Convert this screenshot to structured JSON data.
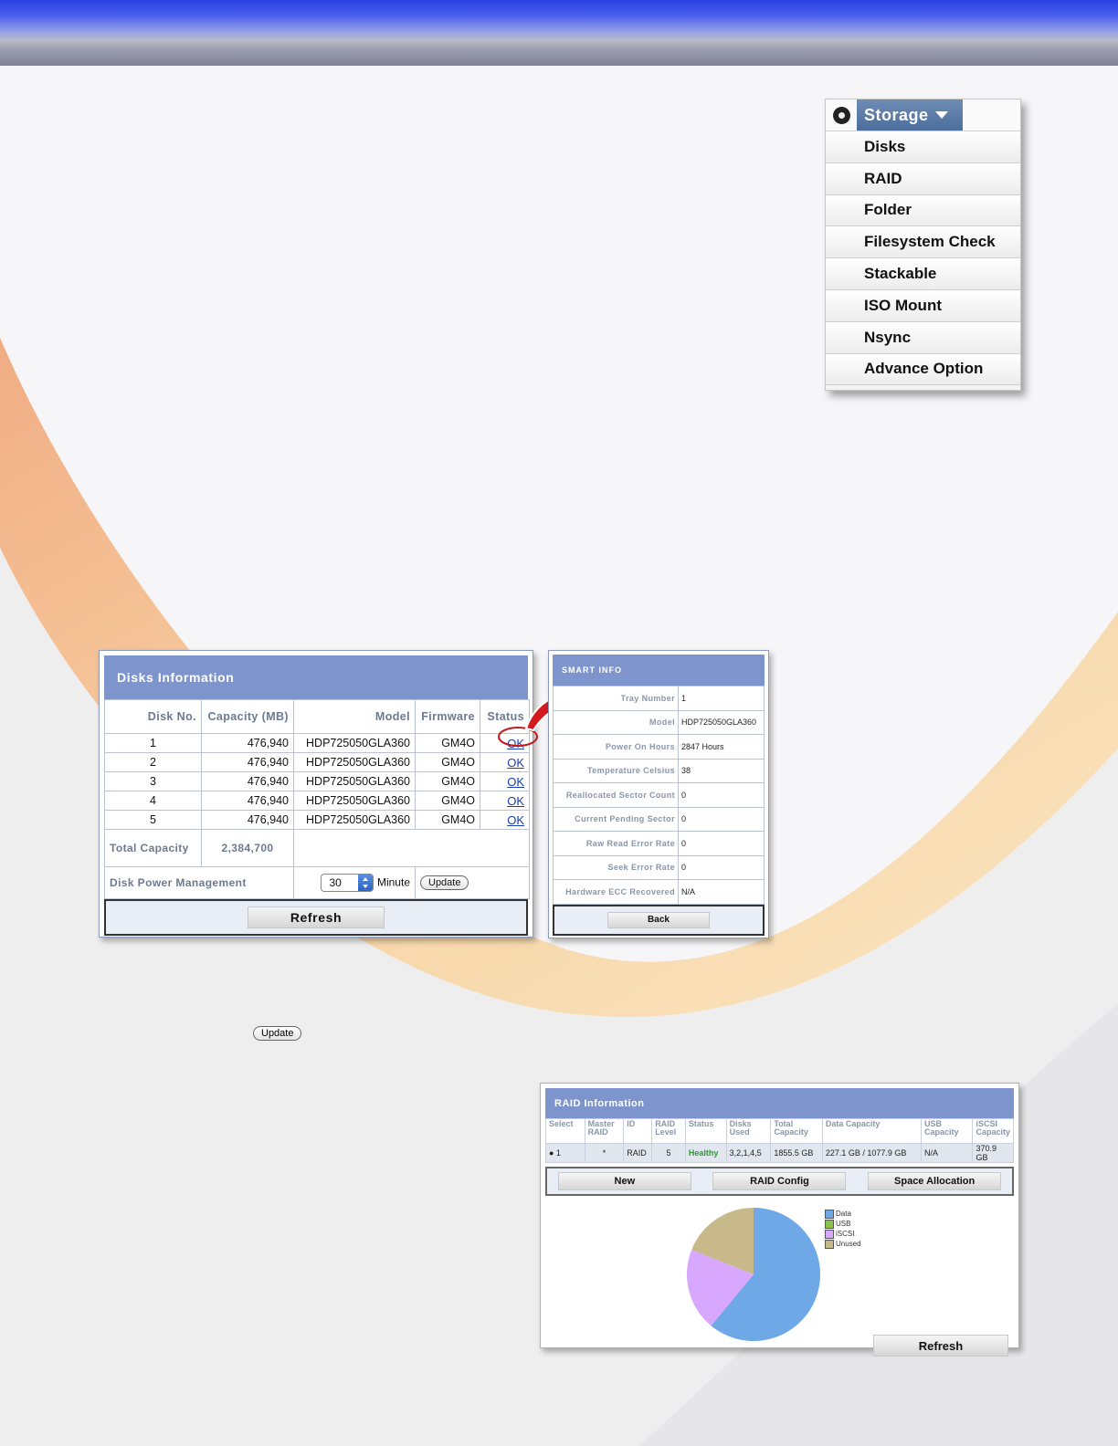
{
  "storage_menu": {
    "title": "Storage",
    "items": [
      "Disks",
      "RAID",
      "Folder",
      "Filesystem Check",
      "Stackable",
      "ISO Mount",
      "Nsync",
      "Advance Option"
    ]
  },
  "disks_info": {
    "title": "Disks Information",
    "columns": [
      "Disk No.",
      "Capacity (MB)",
      "Model",
      "Firmware",
      "Status"
    ],
    "rows": [
      {
        "no": "1",
        "capacity": "476,940",
        "model": "HDP725050GLA360",
        "firmware": "GM4O",
        "status": "OK"
      },
      {
        "no": "2",
        "capacity": "476,940",
        "model": "HDP725050GLA360",
        "firmware": "GM4O",
        "status": "OK"
      },
      {
        "no": "3",
        "capacity": "476,940",
        "model": "HDP725050GLA360",
        "firmware": "GM4O",
        "status": "OK"
      },
      {
        "no": "4",
        "capacity": "476,940",
        "model": "HDP725050GLA360",
        "firmware": "GM4O",
        "status": "OK"
      },
      {
        "no": "5",
        "capacity": "476,940",
        "model": "HDP725050GLA360",
        "firmware": "GM4O",
        "status": "OK"
      }
    ],
    "total_label": "Total Capacity",
    "total_value": "2,384,700",
    "power_label": "Disk Power Management",
    "power_value": "30",
    "power_unit": "Minute",
    "update_label": "Update",
    "refresh_label": "Refresh"
  },
  "smart_info": {
    "title": "SMART INFO",
    "rows": [
      {
        "key": "Tray Number",
        "value": "1"
      },
      {
        "key": "Model",
        "value": "HDP725050GLA360"
      },
      {
        "key": "Power On Hours",
        "value": "2847 Hours"
      },
      {
        "key": "Temperature Celsius",
        "value": "38"
      },
      {
        "key": "Reallocated Sector Count",
        "value": "0"
      },
      {
        "key": "Current Pending Sector",
        "value": "0"
      },
      {
        "key": "Raw Read Error Rate",
        "value": "0"
      },
      {
        "key": "Seek Error Rate",
        "value": "0"
      },
      {
        "key": "Hardware ECC Recovered",
        "value": "N/A"
      }
    ],
    "back_label": "Back"
  },
  "standalone_update_label": "Update",
  "raid_info": {
    "title": "RAID Information",
    "columns": [
      "Select",
      "Master RAID",
      "ID",
      "RAID Level",
      "Status",
      "Disks Used",
      "Total Capacity",
      "Data Capacity",
      "USB Capacity",
      "iSCSI Capacity"
    ],
    "row": {
      "select": "● 1",
      "master": "*",
      "id": "RAID",
      "level": "5",
      "status": "Healthy",
      "disks": "3,2,1,4,5",
      "total": "1855.5 GB",
      "data": "227.1 GB / 1077.9 GB",
      "usb": "N/A",
      "iscsi": "370.9 GB"
    },
    "buttons": {
      "new": "New",
      "config": "RAID Config",
      "space": "Space Allocation"
    },
    "refresh_label": "Refresh"
  },
  "chart_data": {
    "type": "pie",
    "categories": [
      "Data",
      "USB",
      "iSCSI",
      "Unused"
    ],
    "values": [
      61,
      0,
      20,
      19
    ],
    "colors": [
      "#6fa8e6",
      "#8bc34a",
      "#d8a8ff",
      "#c8b98a"
    ],
    "legend": "right"
  }
}
